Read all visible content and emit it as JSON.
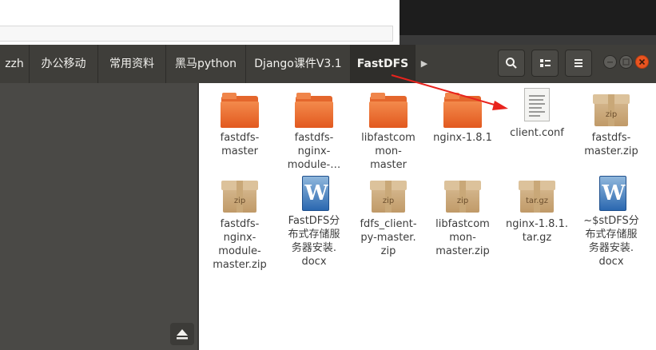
{
  "breadcrumbs": [
    {
      "label": "zzh",
      "active": false
    },
    {
      "label": "办公移动",
      "active": false
    },
    {
      "label": "常用资料",
      "active": false
    },
    {
      "label": "黑马python",
      "active": false
    },
    {
      "label": "Django课件V3.1",
      "active": false
    },
    {
      "label": "FastDFS",
      "active": true
    }
  ],
  "toolbar": {
    "search_icon": "search-icon",
    "view_icon": "list-view-icon",
    "menu_icon": "hamburger-menu-icon"
  },
  "window_controls": [
    "minimize-button",
    "maximize-button",
    "close-button"
  ],
  "files": [
    {
      "name": "fastdfs-\nmaster",
      "type": "folder"
    },
    {
      "name": "fastdfs-\nnginx-\nmodule-…",
      "type": "folder"
    },
    {
      "name": "libfastcom\nmon-\nmaster",
      "type": "folder"
    },
    {
      "name": "nginx-1.8.1",
      "type": "folder"
    },
    {
      "name": "client.conf",
      "type": "text"
    },
    {
      "name": "fastdfs-\nmaster.zip",
      "type": "archive",
      "badge": "zip"
    },
    {
      "name": "fastdfs-\nnginx-\nmodule-\nmaster.zip",
      "type": "archive",
      "badge": "zip"
    },
    {
      "name": "FastDFS分\n布式存储服\n务器安装.\ndocx",
      "type": "word"
    },
    {
      "name": "fdfs_client-\npy-master.\nzip",
      "type": "archive",
      "badge": "zip"
    },
    {
      "name": "libfastcom\nmon-\nmaster.zip",
      "type": "archive",
      "badge": "zip"
    },
    {
      "name": "nginx-1.8.1.\ntar.gz",
      "type": "archive",
      "badge": "tar.gz"
    },
    {
      "name": "~$stDFS分\n布式存储服\n务器安装.\ndocx",
      "type": "word"
    }
  ],
  "colors": {
    "annotation_arrow": "#e8231d",
    "active_crumb": "#2f2e2b",
    "titlebar": "#3f3e3a",
    "sidebar": "#4a4946",
    "close_button": "#e95420"
  }
}
